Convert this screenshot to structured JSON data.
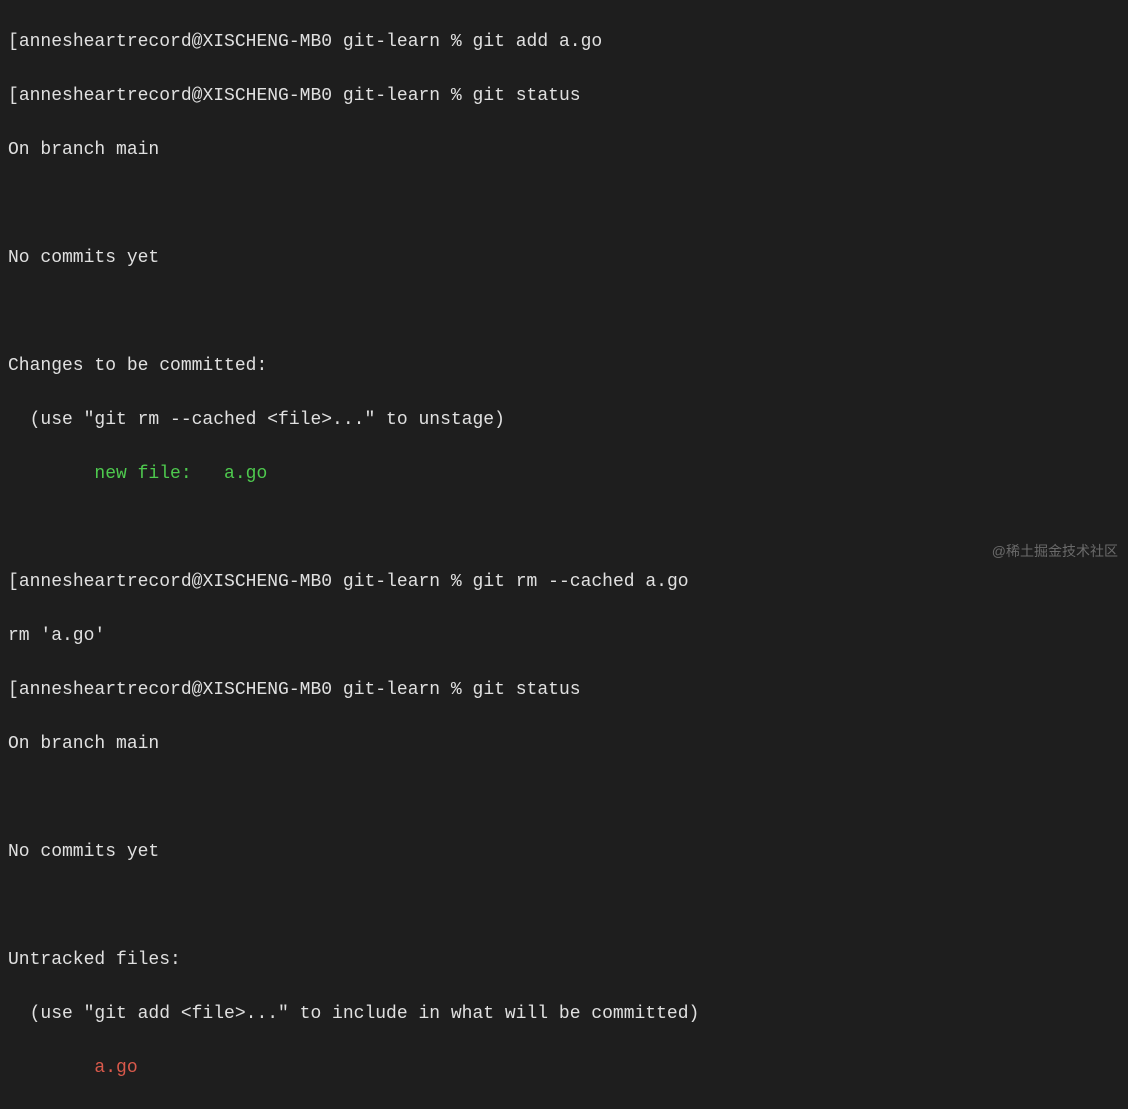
{
  "prompts": {
    "prefix": "[",
    "user_host": "annesheartrecord@XISCHENG-MB0",
    "path": "git-learn",
    "symbol": "%"
  },
  "cmd1": "git add a.go",
  "cmd2": "git status",
  "status1": {
    "branch": "On branch main",
    "no_commits": "No commits yet",
    "changes_header": "Changes to be committed:",
    "unstage_hint": "  (use \"git rm --cached <file>...\" to unstage)",
    "new_file_label": "        new file:   ",
    "new_file_name": "a.go"
  },
  "cmd3": "git rm --cached a.go",
  "rm_output": "rm 'a.go'",
  "cmd4": "git status",
  "status2": {
    "branch": "On branch main",
    "no_commits": "No commits yet",
    "untracked_header": "Untracked files:",
    "add_hint": "  (use \"git add <file>...\" to include in what will be committed)",
    "untracked_indent": "        ",
    "untracked_file": "a.go"
  },
  "watermark": "@稀土掘金技术社区"
}
